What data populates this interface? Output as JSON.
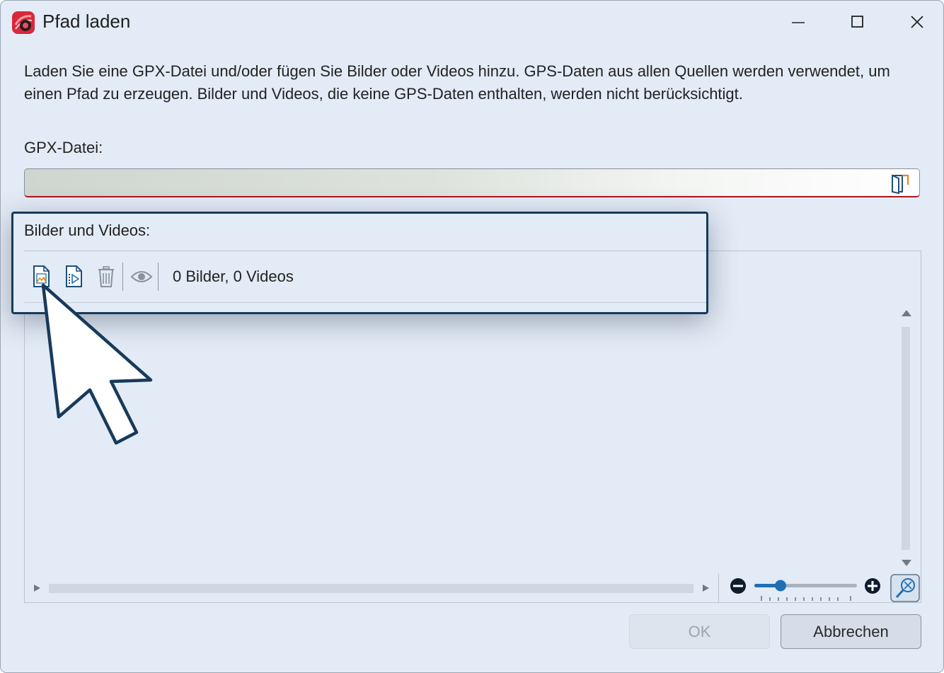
{
  "window": {
    "title": "Pfad laden",
    "app_icon": "app-logo-icon",
    "controls": [
      "minimize-icon",
      "maximize-icon",
      "close-icon"
    ]
  },
  "description": "Laden Sie eine GPX-Datei und/oder fügen Sie Bilder oder Videos hinzu. GPS-Daten aus allen Quellen werden verwendet, um einen Pfad zu erzeugen. Bilder und Videos, die keine GPS-Daten enthalten, werden nicht berücksichtigt.",
  "gpx": {
    "label": "GPX-Datei:",
    "value": "",
    "browse_icon": "folder-open-icon"
  },
  "media": {
    "label": "Bilder und Videos:",
    "toolbar": [
      "add-image-icon",
      "add-video-icon",
      "delete-icon",
      "preview-eye-icon"
    ],
    "count_text": "0 Bilder, 0 Videos"
  },
  "zoom": {
    "level": 0.2,
    "icons": [
      "zoom-out-icon",
      "zoom-in-icon",
      "zoom-fit-icon"
    ]
  },
  "buttons": {
    "ok": "OK",
    "cancel": "Abbrechen"
  },
  "colors": {
    "dialog_bg": "#e3ebf6",
    "accent": "#1f6fb5",
    "highlight_border": "#173a5c",
    "field_underline": "#b0141c"
  }
}
